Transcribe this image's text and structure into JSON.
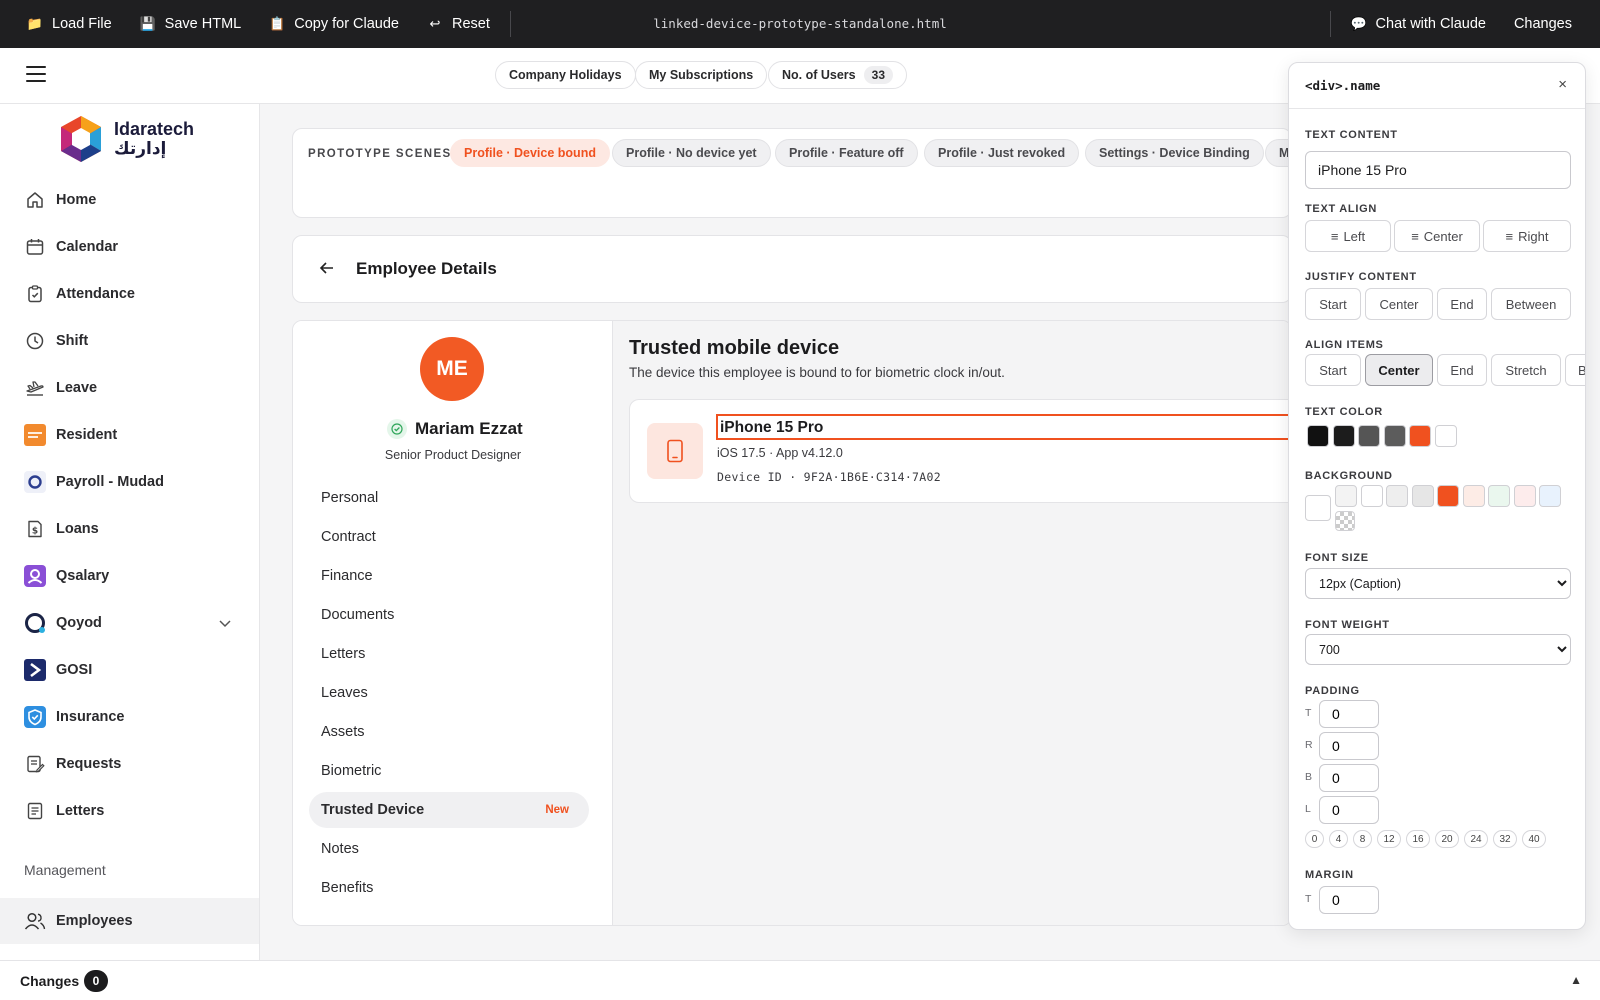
{
  "topbar": {
    "load_file": "Load File",
    "save_html": "Save HTML",
    "copy_for_claude": "Copy for Claude",
    "reset": "Reset",
    "filename": "linked-device-prototype-standalone.html",
    "chat_with_claude": "Chat with Claude",
    "changes": "Changes"
  },
  "header": {
    "company_holidays": "Company Holidays",
    "my_subscriptions": "My Subscriptions",
    "users_label": "No. of Users",
    "users_count": "33"
  },
  "sidebar": {
    "logo_en": "Idaratech",
    "logo_ar": "إدارتك",
    "items": [
      {
        "label": "Home",
        "icon": "home-icon"
      },
      {
        "label": "Calendar",
        "icon": "calendar-icon"
      },
      {
        "label": "Attendance",
        "icon": "attendance-icon"
      },
      {
        "label": "Shift",
        "icon": "clock-icon"
      },
      {
        "label": "Leave",
        "icon": "plane-icon"
      },
      {
        "label": "Resident",
        "icon": "resident-icon"
      },
      {
        "label": "Payroll - Mudad",
        "icon": "mudad-icon"
      },
      {
        "label": "Loans",
        "icon": "loan-icon"
      },
      {
        "label": "Qsalary",
        "icon": "qsalary-icon"
      },
      {
        "label": "Qoyod",
        "icon": "qoyod-icon"
      },
      {
        "label": "GOSI",
        "icon": "gosi-icon"
      },
      {
        "label": "Insurance",
        "icon": "insurance-icon"
      },
      {
        "label": "Requests",
        "icon": "requests-icon"
      },
      {
        "label": "Letters",
        "icon": "letters-icon"
      }
    ],
    "management_label": "Management",
    "employees": "Employees"
  },
  "scenes": {
    "label": "PROTOTYPE SCENES",
    "items": [
      "Profile · Device bound",
      "Profile · No device yet",
      "Profile · Feature off",
      "Profile · Just revoked",
      "Settings · Device Binding",
      "M"
    ]
  },
  "employee_details": {
    "title": "Employee Details"
  },
  "profile": {
    "initials": "ME",
    "name": "Mariam Ezzat",
    "role": "Senior Product Designer",
    "tabs": [
      "Personal",
      "Contract",
      "Finance",
      "Documents",
      "Letters",
      "Leaves",
      "Assets",
      "Biometric",
      "Trusted Device",
      "Notes",
      "Benefits"
    ],
    "new_badge": "New"
  },
  "trusted_device": {
    "title": "Trusted mobile device",
    "description": "The device this employee is bound to for biometric clock in/out.",
    "device_name": "iPhone 15 Pro",
    "os_line": "iOS 17.5 · App v4.12.0",
    "device_id": "Device ID · 9F2A·1B6E·C314·7A02"
  },
  "inspector": {
    "title": "<div>.name",
    "text_content_label": "TEXT CONTENT",
    "text_content_value": "iPhone 15 Pro",
    "text_align_label": "TEXT ALIGN",
    "text_align": [
      "Left",
      "Center",
      "Right"
    ],
    "justify_label": "JUSTIFY CONTENT",
    "justify": [
      "Start",
      "Center",
      "End",
      "Between"
    ],
    "align_items_label": "ALIGN ITEMS",
    "align_items": [
      "Start",
      "Center",
      "End",
      "Stretch",
      "Ba"
    ],
    "align_items_selected": "Center",
    "text_color_label": "TEXT COLOR",
    "text_colors": [
      "#111111",
      "#1c1c1c",
      "#555555",
      "#5c5c5c",
      "#f0511f",
      "#ffffff"
    ],
    "background_label": "BACKGROUND",
    "bg_colors": [
      "#ffffff",
      "#f3f3f3",
      "#ffffff",
      "#eeeeee",
      "#e6e6e6",
      "#f0511f",
      "#fdece6",
      "#eaf7ee",
      "#fdecec",
      "#e8f2fd"
    ],
    "font_size_label": "FONT SIZE",
    "font_size_value": "12px (Caption)",
    "font_weight_label": "FONT WEIGHT",
    "font_weight_value": "700",
    "padding_label": "PADDING",
    "padding": {
      "T": "0",
      "R": "0",
      "B": "0",
      "L": "0"
    },
    "padding_presets": [
      "0",
      "4",
      "8",
      "12",
      "16",
      "20",
      "24",
      "32",
      "40"
    ],
    "margin_label": "MARGIN",
    "margin_t": "0"
  },
  "bottombar": {
    "label": "Changes",
    "count": "0"
  }
}
